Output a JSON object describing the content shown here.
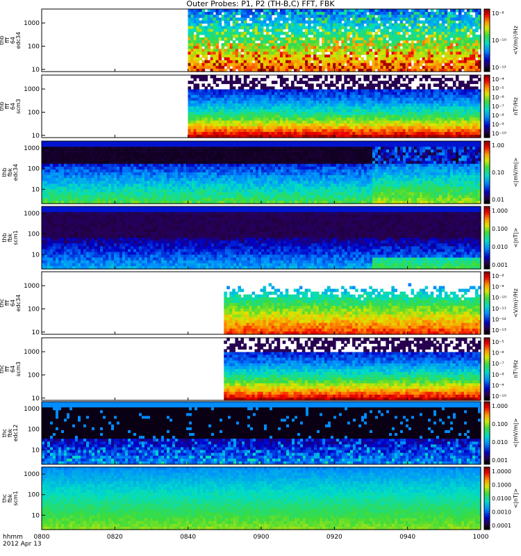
{
  "title": "Outer Probes: P1, P2 (TH-B,C) FFT, FBK",
  "footer": {
    "time_label": "hhmm",
    "date_label": "2012 Apr 13"
  },
  "chart_data": {
    "type": "heatmap",
    "x_ticks": [
      "0800",
      "0820",
      "0840",
      "0900",
      "0920",
      "0940",
      "1000"
    ],
    "panels": [
      {
        "id": "thb-fff-64-edc34",
        "ylabel": [
          "thb",
          "fff",
          "64",
          "edc34"
        ],
        "yticks": [
          "1000",
          "100",
          "10"
        ],
        "ylog_range": [
          8,
          4000
        ],
        "data_start": 0.333,
        "style": "fff-e",
        "colorbar_label": "<V/m)²/Hz",
        "colorbar_ticks": [
          "10⁻⁸",
          "10⁻¹⁰",
          "10⁻¹²"
        ]
      },
      {
        "id": "thb-fff-64-scm3",
        "ylabel": [
          "thb",
          "fff",
          "64",
          "scm3"
        ],
        "yticks": [
          "1000",
          "100",
          "10"
        ],
        "ylog_range": [
          8,
          4000
        ],
        "data_start": 0.333,
        "style": "fff-b",
        "colorbar_label": "nT²/Hz",
        "colorbar_ticks": [
          "10⁻⁴",
          "10⁻⁵",
          "10⁻⁶",
          "10⁻⁷",
          "10⁻⁸",
          "10⁻⁹",
          "10⁻¹⁰"
        ]
      },
      {
        "id": "thb-fbk-edc34",
        "ylabel": [
          "thb",
          "fbk",
          "edc34"
        ],
        "yticks": [
          "1000",
          "100",
          "10"
        ],
        "ylog_range": [
          2,
          2200
        ],
        "data_start": 0,
        "style": "fbk-e",
        "colorbar_label": "<|mV/m|>",
        "colorbar_ticks": [
          "1.00",
          "0.10",
          "0.01"
        ]
      },
      {
        "id": "thb-fbk-scm1",
        "ylabel": [
          "thb",
          "fbk",
          "scm1"
        ],
        "yticks": [
          "1000",
          "100",
          "10"
        ],
        "ylog_range": [
          2,
          2200
        ],
        "data_start": 0,
        "style": "fbk-b",
        "colorbar_label": "<|nT|>",
        "colorbar_ticks": [
          "1.000",
          "0.100",
          "0.010",
          "0.001"
        ]
      },
      {
        "id": "thc-fff-64-edc34",
        "ylabel": [
          "thc",
          "fff",
          "64",
          "edc34"
        ],
        "yticks": [
          "1000",
          "100",
          "10"
        ],
        "ylog_range": [
          8,
          4000
        ],
        "data_start": 0.415,
        "style": "fff-e2",
        "colorbar_label": "<V/m)²/Hz",
        "colorbar_ticks": [
          "10⁻⁸",
          "10⁻⁹",
          "10⁻¹⁰",
          "10⁻¹¹",
          "10⁻¹²",
          "10⁻¹³"
        ]
      },
      {
        "id": "thc-fff-64-scm3",
        "ylabel": [
          "thc",
          "fff",
          "64",
          "scm3"
        ],
        "yticks": [
          "1000",
          "100",
          "10"
        ],
        "ylog_range": [
          8,
          4000
        ],
        "data_start": 0.415,
        "style": "fff-b",
        "colorbar_label": "nT²/Hz",
        "colorbar_ticks": [
          "10⁻⁵",
          "10⁻⁶",
          "10⁻⁷",
          "10⁻⁸",
          "10⁻⁹",
          "10⁻¹⁰"
        ]
      },
      {
        "id": "thc-fbk-edc12",
        "ylabel": [
          "thc",
          "fbk",
          "edc12"
        ],
        "yticks": [
          "1000",
          "100",
          "10"
        ],
        "ylog_range": [
          2,
          2200
        ],
        "data_start": 0,
        "style": "fbk-e2",
        "colorbar_label": "<|mV/m|>",
        "colorbar_ticks": [
          "1.000",
          "0.100",
          "0.010",
          "0.001"
        ]
      },
      {
        "id": "thc-fbk-scm1",
        "ylabel": [
          "thc",
          "fbk",
          "scm1"
        ],
        "yticks": [
          "1000",
          "100",
          "10"
        ],
        "ylog_range": [
          2,
          2200
        ],
        "data_start": 0,
        "style": "fbk-b2",
        "colorbar_label": "<|nT|>",
        "colorbar_ticks": [
          "1.0000",
          "0.1000",
          "0.0100",
          "0.0010",
          "0.0001"
        ]
      }
    ],
    "grid": false
  }
}
